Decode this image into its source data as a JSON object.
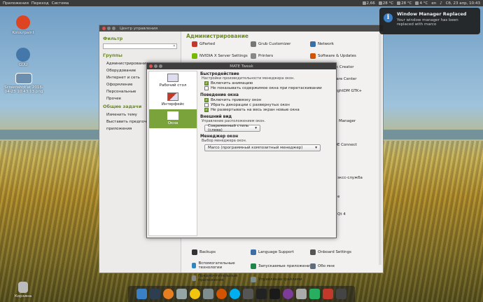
{
  "top_panel": {
    "menus": [
      "Приложения",
      "Переход",
      "Система"
    ],
    "tray": [
      "2,66",
      "28 °C",
      "28 °C",
      "4 °C",
      "en",
      "Сб, 23 апр, 10:43"
    ]
  },
  "desktop_icons": [
    {
      "label": "Kolourpaint",
      "color": "#dd4422"
    },
    {
      "label": "GUU",
      "color": "#4477aa"
    },
    {
      "label": "Screenshot at 2016-04-23 10:43:13.png",
      "color": "#6c8fb0"
    },
    {
      "label": "Корзина",
      "color": "#bbbbbb"
    }
  ],
  "notification": {
    "title": "Window Manager Replaced",
    "body": "Your window manager has been replaced with marco"
  },
  "control_center": {
    "title": "Центр управления",
    "filter_header": "Фильтр",
    "groups_header": "Группы",
    "groups": [
      "Администрирование",
      "Оборудование",
      "Интернет и сеть",
      "Оформление",
      "Персональные",
      "Прочее"
    ],
    "tasks_header": "Общие задачи",
    "tasks": [
      "Изменить тему",
      "Выставить предпочтительные приложения"
    ],
    "section_title": "Администрирование",
    "apps": [
      "GParted",
      "Grub Customizer",
      "Network",
      "NVIDIA X Server Settings",
      "Printers",
      "Software & Updates",
      "k Creator",
      "Software Center",
      "LightDM GTK+",
      "Manager",
      "KDE Connect",
      "эксс-служба",
      "e",
      "Qt 4",
      "Backups",
      "Language Support",
      "Onboard Settings",
      "Вспомогательные технологии",
      "Запускаемые приложения",
      "Обо мне",
      "Предпочтительные приложения",
      "Управление файлами"
    ]
  },
  "mate_tweak": {
    "title": "MATE Tweak",
    "nav": [
      "Рабочий стол",
      "Интерфейс",
      "Окна"
    ],
    "performance": {
      "header": "Быстродействие",
      "sub": "Настройки производительности менеджера окон.",
      "options": [
        {
          "label": "Включить анимацию",
          "checked": true
        },
        {
          "label": "Не показывать содержимое окна при перетаскивании",
          "checked": false
        }
      ]
    },
    "behaviour": {
      "header": "Поведение окна",
      "options": [
        {
          "label": "Включить привязку окон",
          "checked": true
        },
        {
          "label": "Убрать декорации с развернутых окон",
          "checked": false
        },
        {
          "label": "Не развертывать на весь экран новые окна",
          "checked": true
        }
      ]
    },
    "appearance": {
      "header": "Внешний вид",
      "sub": "Управление расположением окон.",
      "value": "Современный стиль (слева)"
    },
    "wm": {
      "header": "Менеджер окон",
      "sub": "Выбор менеджера окон.",
      "value": "Marco (программный композитный менеджер)"
    }
  },
  "dock_icons": [
    "files",
    "terminal",
    "firefox",
    "mail",
    "wifi",
    "camera",
    "firefox2",
    "skype",
    "system-monitor",
    "terminal2",
    "monitor",
    "tor",
    "settings",
    "mate-tweak",
    "music",
    "power"
  ]
}
